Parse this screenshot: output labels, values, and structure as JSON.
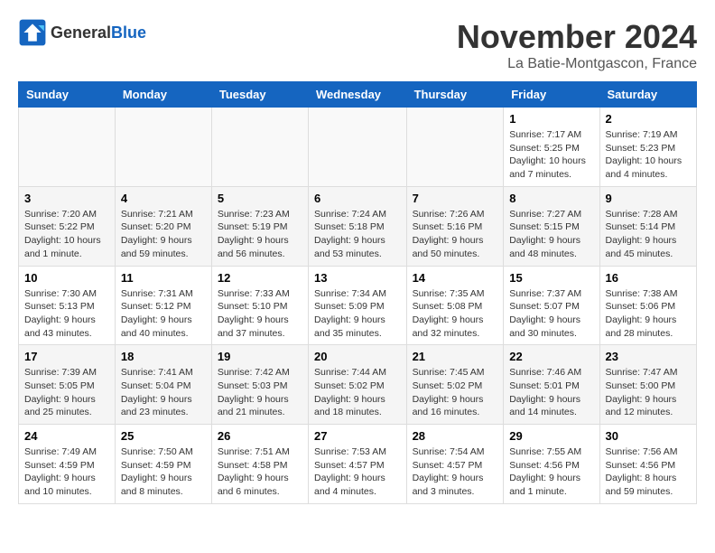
{
  "header": {
    "logo_general": "General",
    "logo_blue": "Blue",
    "month_title": "November 2024",
    "location": "La Batie-Montgascon, France"
  },
  "calendar": {
    "weekdays": [
      "Sunday",
      "Monday",
      "Tuesday",
      "Wednesday",
      "Thursday",
      "Friday",
      "Saturday"
    ],
    "weeks": [
      [
        {
          "day": "",
          "info": ""
        },
        {
          "day": "",
          "info": ""
        },
        {
          "day": "",
          "info": ""
        },
        {
          "day": "",
          "info": ""
        },
        {
          "day": "",
          "info": ""
        },
        {
          "day": "1",
          "info": "Sunrise: 7:17 AM\nSunset: 5:25 PM\nDaylight: 10 hours and 7 minutes."
        },
        {
          "day": "2",
          "info": "Sunrise: 7:19 AM\nSunset: 5:23 PM\nDaylight: 10 hours and 4 minutes."
        }
      ],
      [
        {
          "day": "3",
          "info": "Sunrise: 7:20 AM\nSunset: 5:22 PM\nDaylight: 10 hours and 1 minute."
        },
        {
          "day": "4",
          "info": "Sunrise: 7:21 AM\nSunset: 5:20 PM\nDaylight: 9 hours and 59 minutes."
        },
        {
          "day": "5",
          "info": "Sunrise: 7:23 AM\nSunset: 5:19 PM\nDaylight: 9 hours and 56 minutes."
        },
        {
          "day": "6",
          "info": "Sunrise: 7:24 AM\nSunset: 5:18 PM\nDaylight: 9 hours and 53 minutes."
        },
        {
          "day": "7",
          "info": "Sunrise: 7:26 AM\nSunset: 5:16 PM\nDaylight: 9 hours and 50 minutes."
        },
        {
          "day": "8",
          "info": "Sunrise: 7:27 AM\nSunset: 5:15 PM\nDaylight: 9 hours and 48 minutes."
        },
        {
          "day": "9",
          "info": "Sunrise: 7:28 AM\nSunset: 5:14 PM\nDaylight: 9 hours and 45 minutes."
        }
      ],
      [
        {
          "day": "10",
          "info": "Sunrise: 7:30 AM\nSunset: 5:13 PM\nDaylight: 9 hours and 43 minutes."
        },
        {
          "day": "11",
          "info": "Sunrise: 7:31 AM\nSunset: 5:12 PM\nDaylight: 9 hours and 40 minutes."
        },
        {
          "day": "12",
          "info": "Sunrise: 7:33 AM\nSunset: 5:10 PM\nDaylight: 9 hours and 37 minutes."
        },
        {
          "day": "13",
          "info": "Sunrise: 7:34 AM\nSunset: 5:09 PM\nDaylight: 9 hours and 35 minutes."
        },
        {
          "day": "14",
          "info": "Sunrise: 7:35 AM\nSunset: 5:08 PM\nDaylight: 9 hours and 32 minutes."
        },
        {
          "day": "15",
          "info": "Sunrise: 7:37 AM\nSunset: 5:07 PM\nDaylight: 9 hours and 30 minutes."
        },
        {
          "day": "16",
          "info": "Sunrise: 7:38 AM\nSunset: 5:06 PM\nDaylight: 9 hours and 28 minutes."
        }
      ],
      [
        {
          "day": "17",
          "info": "Sunrise: 7:39 AM\nSunset: 5:05 PM\nDaylight: 9 hours and 25 minutes."
        },
        {
          "day": "18",
          "info": "Sunrise: 7:41 AM\nSunset: 5:04 PM\nDaylight: 9 hours and 23 minutes."
        },
        {
          "day": "19",
          "info": "Sunrise: 7:42 AM\nSunset: 5:03 PM\nDaylight: 9 hours and 21 minutes."
        },
        {
          "day": "20",
          "info": "Sunrise: 7:44 AM\nSunset: 5:02 PM\nDaylight: 9 hours and 18 minutes."
        },
        {
          "day": "21",
          "info": "Sunrise: 7:45 AM\nSunset: 5:02 PM\nDaylight: 9 hours and 16 minutes."
        },
        {
          "day": "22",
          "info": "Sunrise: 7:46 AM\nSunset: 5:01 PM\nDaylight: 9 hours and 14 minutes."
        },
        {
          "day": "23",
          "info": "Sunrise: 7:47 AM\nSunset: 5:00 PM\nDaylight: 9 hours and 12 minutes."
        }
      ],
      [
        {
          "day": "24",
          "info": "Sunrise: 7:49 AM\nSunset: 4:59 PM\nDaylight: 9 hours and 10 minutes."
        },
        {
          "day": "25",
          "info": "Sunrise: 7:50 AM\nSunset: 4:59 PM\nDaylight: 9 hours and 8 minutes."
        },
        {
          "day": "26",
          "info": "Sunrise: 7:51 AM\nSunset: 4:58 PM\nDaylight: 9 hours and 6 minutes."
        },
        {
          "day": "27",
          "info": "Sunrise: 7:53 AM\nSunset: 4:57 PM\nDaylight: 9 hours and 4 minutes."
        },
        {
          "day": "28",
          "info": "Sunrise: 7:54 AM\nSunset: 4:57 PM\nDaylight: 9 hours and 3 minutes."
        },
        {
          "day": "29",
          "info": "Sunrise: 7:55 AM\nSunset: 4:56 PM\nDaylight: 9 hours and 1 minute."
        },
        {
          "day": "30",
          "info": "Sunrise: 7:56 AM\nSunset: 4:56 PM\nDaylight: 8 hours and 59 minutes."
        }
      ]
    ]
  }
}
